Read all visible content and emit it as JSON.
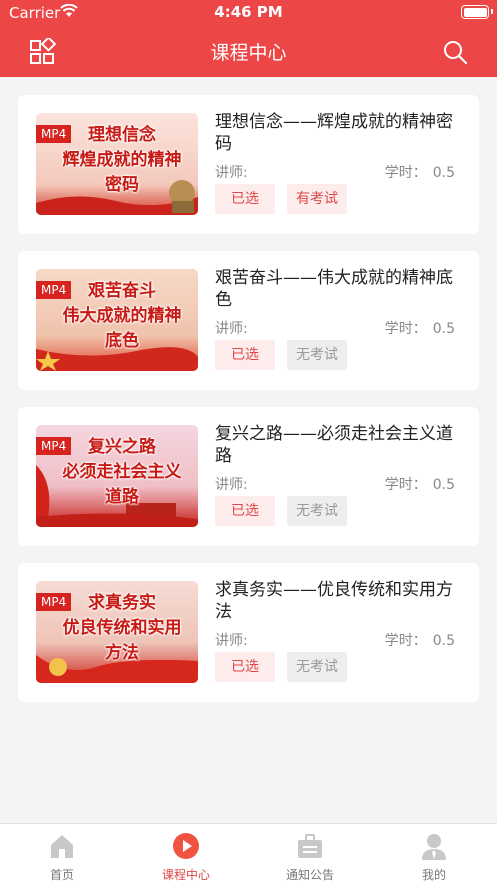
{
  "status_bar": {
    "carrier": "Carrier",
    "time": "4:46 PM"
  },
  "nav": {
    "title": "课程中心",
    "menu_icon": "grid-icon",
    "search_icon": "search-icon"
  },
  "courses": [
    {
      "badge": "MP4",
      "thumb_line1": "理想信念",
      "thumb_line2": "辉煌成就的精神",
      "thumb_line3": "密码",
      "title": "理想信念——辉煌成就的精神密码",
      "teacher_label": "讲师:",
      "hours_label": "学时：",
      "hours": "0.5",
      "selected_label": "已选",
      "exam_label": "有考试",
      "has_exam": true
    },
    {
      "badge": "MP4",
      "thumb_line1": "艰苦奋斗",
      "thumb_line2": "伟大成就的精神",
      "thumb_line3": "底色",
      "title": "艰苦奋斗——伟大成就的精神底色",
      "teacher_label": "讲师:",
      "hours_label": "学时：",
      "hours": "0.5",
      "selected_label": "已选",
      "exam_label": "无考试",
      "has_exam": false
    },
    {
      "badge": "MP4",
      "thumb_line1": "复兴之路",
      "thumb_line2": "必须走社会主义",
      "thumb_line3": "道路",
      "title": "复兴之路——必须走社会主义道路",
      "teacher_label": "讲师:",
      "hours_label": "学时：",
      "hours": "0.5",
      "selected_label": "已选",
      "exam_label": "无考试",
      "has_exam": false
    },
    {
      "badge": "MP4",
      "thumb_line1": "求真务实",
      "thumb_line2": "优良传统和实用",
      "thumb_line3": "方法",
      "title": "求真务实——优良传统和实用方法",
      "teacher_label": "讲师:",
      "hours_label": "学时：",
      "hours": "0.5",
      "selected_label": "已选",
      "exam_label": "无考试",
      "has_exam": false
    }
  ],
  "tabs": [
    {
      "label": "首页",
      "icon": "home-icon",
      "active": false
    },
    {
      "label": "课程中心",
      "icon": "play-icon",
      "active": true
    },
    {
      "label": "通知公告",
      "icon": "briefcase-icon",
      "active": false
    },
    {
      "label": "我的",
      "icon": "user-icon",
      "active": false
    }
  ],
  "colors": {
    "brand": "#ec4646",
    "accent_text": "#e04848",
    "tag_bg": "#fdecec",
    "muted_tag_bg": "#eeeeee"
  }
}
